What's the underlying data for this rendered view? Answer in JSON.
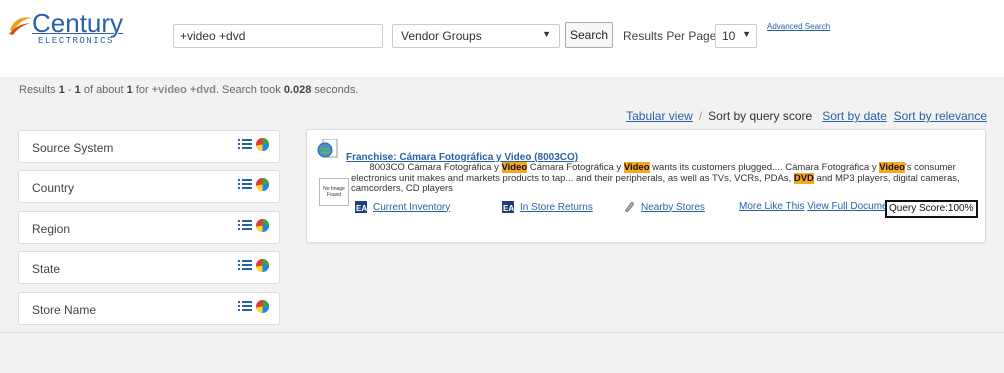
{
  "logo": {
    "brand": "Century",
    "sub": "ELECTRONICS"
  },
  "search": {
    "query": "+video +dvd",
    "vendor_group": "Vendor Groups",
    "button_label": "Search"
  },
  "results_per_page": {
    "label": "Results Per Page :",
    "value": "10"
  },
  "advanced_search_label": "Advanced Search",
  "summary": {
    "prefix": "Results ",
    "from": "1",
    "dash": " - ",
    "to": "1",
    "of_about": " of about ",
    "total": "1",
    "for": " for ",
    "query": "+video +dvd",
    "took": ". Search took ",
    "seconds_value": "0.028",
    "seconds_suffix": " seconds."
  },
  "sort_bar": {
    "tabular_view": "Tabular view",
    "separator": "/",
    "current": "Sort by query score",
    "by_date": "Sort by date",
    "by_relevance": "Sort by relevance"
  },
  "facets": [
    {
      "label": "Source System"
    },
    {
      "label": "Country"
    },
    {
      "label": "Region"
    },
    {
      "label": "State"
    },
    {
      "label": "Store Name"
    }
  ],
  "result": {
    "title": "Franchise: Cámara Fotográfica y Video (8003CO)",
    "no_image": "No Image Found",
    "snippet": {
      "p1": "8003CO Cámara Fotográfica y ",
      "h1": "Video",
      "p2": " Cámara Fotográfica y ",
      "h2": "Video",
      "p3": " wants its customers plugged.... Cámara Fotográfica y ",
      "h3": "Video",
      "p4": "'s consumer electronics unit makes and markets products to tap... and their peripherals, as well as TVs, VCRs, PDAs, ",
      "h4": "DVD",
      "p5": " and MP3 players, digital cameras, camcorders, CD players"
    },
    "links": {
      "current_inventory": "Current Inventory",
      "in_store_returns": "In Store Returns",
      "nearby_stores": "Nearby Stores",
      "more_like_this": "More Like This",
      "view_full_document": "View Full Document",
      "query_score": "Query Score:100%"
    }
  },
  "colors": {
    "link": "#2a62a8",
    "highlight": "#f5a623",
    "background": "#f2f2f2"
  }
}
